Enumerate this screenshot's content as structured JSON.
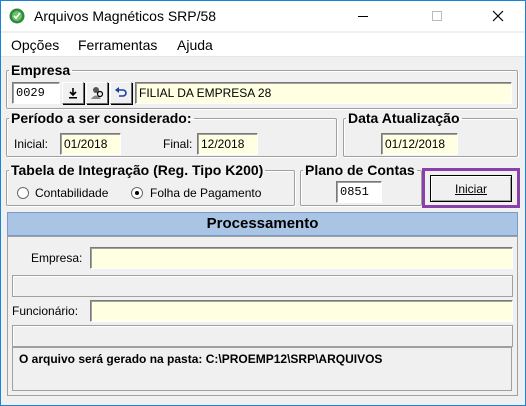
{
  "window": {
    "title": "Arquivos Magnéticos SRP/58"
  },
  "menu": {
    "items": [
      {
        "label": "Opções"
      },
      {
        "label": "Ferramentas"
      },
      {
        "label": "Ajuda"
      }
    ]
  },
  "empresa": {
    "legend": "Empresa",
    "code": "0029",
    "name": "FILIAL DA EMPRESA 28"
  },
  "periodo": {
    "legend": "Período a ser considerado:",
    "inicial_label": "Inicial:",
    "inicial_value": "01/2018",
    "final_label": "Final:",
    "final_value": "12/2018"
  },
  "data_atualizacao": {
    "legend": "Data Atualização",
    "value": "01/12/2018"
  },
  "tabela": {
    "legend": "Tabela de Integração (Reg. Tipo K200)",
    "option1": "Contabilidade",
    "option2": "Folha de Pagamento",
    "selected": "Folha de Pagamento"
  },
  "plano": {
    "legend": "Plano de Contas",
    "value": "0851"
  },
  "iniciar_label": "Iniciar",
  "processamento": {
    "title": "Processamento",
    "empresa_label": "Empresa:",
    "empresa_value": "",
    "funcionario_label": "Funcionário:",
    "funcionario_value": "",
    "info_text": "O arquivo será gerado na pasta: C:\\PROEMP12\\SRP\\ARQUIVOS"
  }
}
